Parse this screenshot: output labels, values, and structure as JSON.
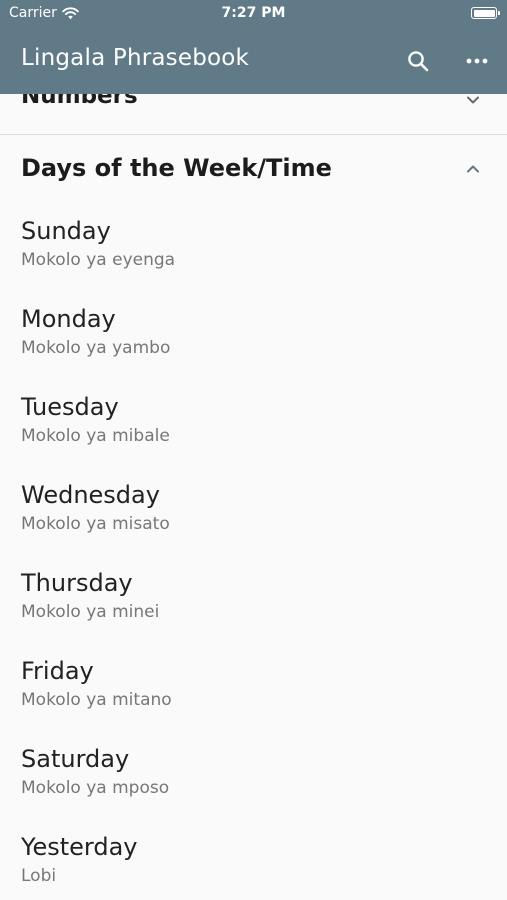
{
  "status_bar": {
    "carrier": "Carrier",
    "time": "7:27 PM"
  },
  "app_bar": {
    "title": "Lingala Phrasebook",
    "color": "#617a87",
    "actions": [
      "search-icon",
      "more-horizontal-icon"
    ]
  },
  "sections": {
    "collapsed": {
      "title": "Numbers",
      "state": "collapsed"
    },
    "expanded": {
      "title": "Days of the Week/Time",
      "state": "expanded"
    }
  },
  "phrases": [
    {
      "english": "Sunday",
      "lingala": "Mokolo ya eyenga"
    },
    {
      "english": "Monday",
      "lingala": "Mokolo ya yambo"
    },
    {
      "english": "Tuesday",
      "lingala": "Mokolo ya mibale"
    },
    {
      "english": "Wednesday",
      "lingala": "Mokolo ya misato"
    },
    {
      "english": "Thursday",
      "lingala": "Mokolo ya minei"
    },
    {
      "english": "Friday",
      "lingala": "Mokolo ya mitano"
    },
    {
      "english": "Saturday",
      "lingala": "Mokolo ya mposo"
    },
    {
      "english": "Yesterday",
      "lingala": "Lobi"
    }
  ]
}
